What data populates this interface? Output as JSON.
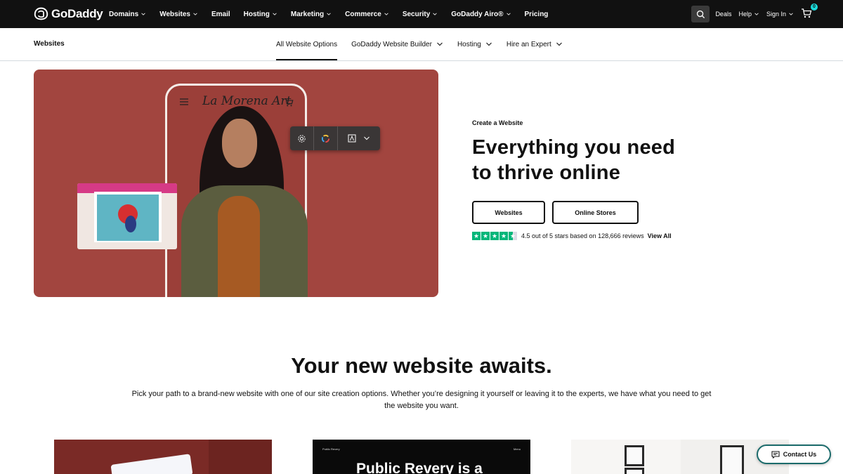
{
  "header": {
    "logo_text": "GoDaddy",
    "nav": [
      {
        "label": "Domains",
        "caret": true
      },
      {
        "label": "Websites",
        "caret": true
      },
      {
        "label": "Email",
        "caret": false
      },
      {
        "label": "Hosting",
        "caret": true
      },
      {
        "label": "Marketing",
        "caret": true
      },
      {
        "label": "Commerce",
        "caret": true
      },
      {
        "label": "Security",
        "caret": true
      },
      {
        "label": "GoDaddy Airo®",
        "caret": true
      },
      {
        "label": "Pricing",
        "caret": false
      }
    ],
    "deals": "Deals",
    "help": "Help",
    "sign_in": "Sign In",
    "cart_count": "0"
  },
  "subnav": {
    "title": "Websites",
    "links": [
      {
        "label": "All Website Options",
        "active": true
      },
      {
        "label": "GoDaddy Website Builder",
        "caret": true
      },
      {
        "label": "Hosting",
        "caret": true
      },
      {
        "label": "Hire an Expert",
        "caret": true
      }
    ]
  },
  "hero": {
    "phone_brand": "La Morena Art",
    "eyebrow": "Create a Website",
    "title": "Everything you need to thrive online",
    "buttons": [
      "Websites",
      "Online Stores"
    ],
    "rating_text": "4.5 out of 5 stars based on 128,666 reviews",
    "rating_value": 4.5,
    "view_all": "View All"
  },
  "section": {
    "title": "Your new website awaits.",
    "description": "Pick your path to a brand-new website with one of our site creation options. Whether you’re designing it yourself or leaving it to the experts, we have what you need to get the website you want."
  },
  "cards": {
    "card2_small": "Public Revery",
    "card2_menu": "Menu",
    "card2_big": "Public Revery is a"
  },
  "contact": {
    "label": "Contact Us"
  },
  "colors": {
    "nav_bg": "#111111",
    "hero_bg": "#a2453f",
    "accent": "#1bdbdb",
    "trustpilot": "#00b67a"
  }
}
